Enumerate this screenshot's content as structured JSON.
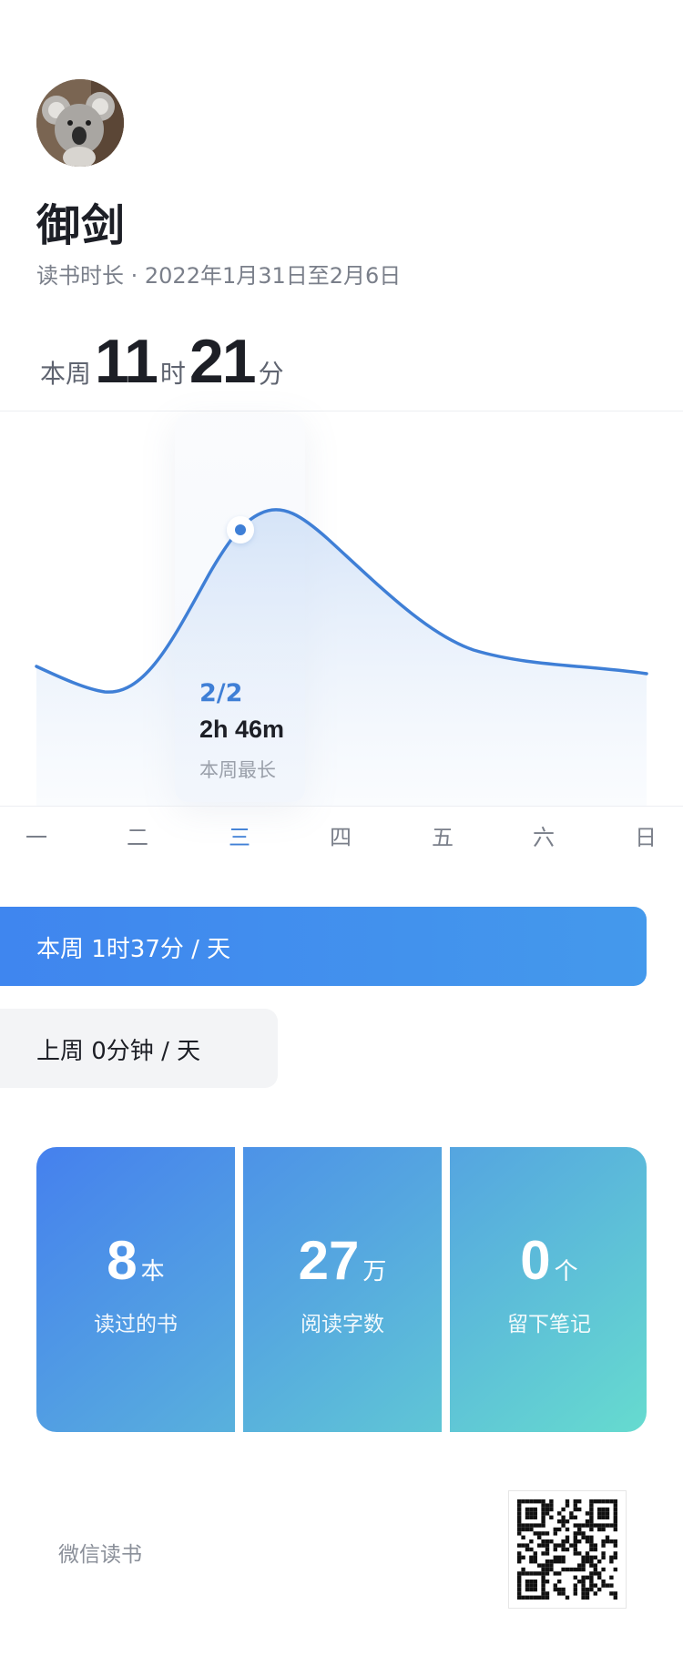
{
  "profile": {
    "name": "御剑",
    "subtitle": "读书时长 · 2022年1月31日至2月6日"
  },
  "week_total": {
    "prefix": "本周",
    "hours": "11",
    "hour_unit": "时",
    "minutes": "21",
    "minute_unit": "分"
  },
  "chart_data": {
    "type": "area",
    "categories": [
      "一",
      "二",
      "三",
      "四",
      "五",
      "六",
      "日"
    ],
    "highlight_index": 2,
    "tooltip": {
      "date": "2/2",
      "value": "2h 46m",
      "label": "本周最长"
    }
  },
  "averages": {
    "this_week": "本周 1时37分 / 天",
    "last_week": "上周 0分钟 / 天"
  },
  "stats": [
    {
      "value": "8",
      "unit": "本",
      "label": "读过的书"
    },
    {
      "value": "27",
      "unit": "万",
      "label": "阅读字数"
    },
    {
      "value": "0",
      "unit": "个",
      "label": "留下笔记"
    }
  ],
  "footer": {
    "brand": "微信读书"
  },
  "colors": {
    "accent": "#3f7fd6",
    "bar": "#4190ee"
  },
  "icons": {
    "avatar": "koala-avatar",
    "qr": "qr-code"
  }
}
